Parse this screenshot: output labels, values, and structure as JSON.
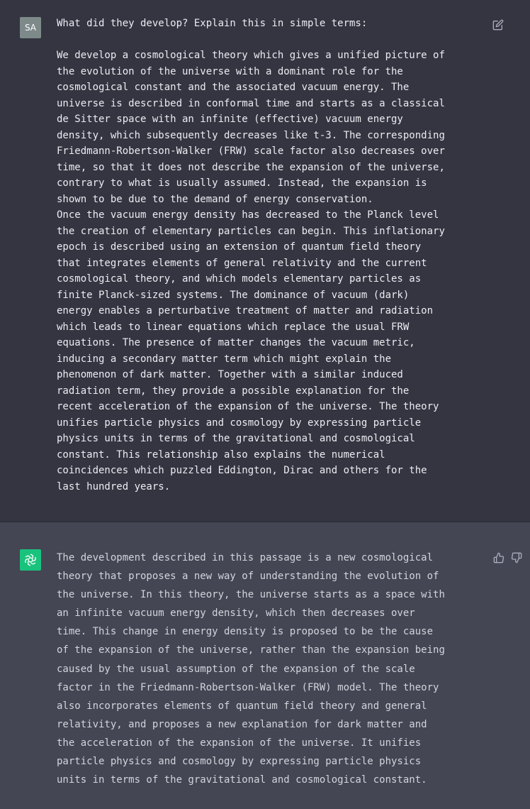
{
  "user_message": {
    "avatar_initials": "SA",
    "text": "What did they develop? Explain this in simple terms:\n\nWe develop a cosmological theory which gives a unified picture of\nthe evolution of the universe with a dominant role for the\ncosmological constant and the associated vacuum energy. The\nuniverse is described in conformal time and starts as a classical\nde Sitter space with an infinite (effective) vacuum energy\ndensity, which subsequently decreases like t-3. The corresponding\nFriedmann-Robertson-Walker (FRW) scale factor also decreases over\ntime, so that it does not describe the expansion of the universe,\ncontrary to what is usually assumed. Instead, the expansion is\nshown to be due to the demand of energy conservation.\nOnce the vacuum energy density has decreased to the Planck level\nthe creation of elementary particles can begin. This inflationary\nepoch is described using an extension of quantum field theory\nthat integrates elements of general relativity and the current\ncosmological theory, and which models elementary particles as\nfinite Planck-sized systems. The dominance of vacuum (dark)\nenergy enables a perturbative treatment of matter and radiation\nwhich leads to linear equations which replace the usual FRW\nequations. The presence of matter changes the vacuum metric,\ninducing a secondary matter term which might explain the\nphenomenon of dark matter. Together with a similar induced\nradiation term, they provide a possible explanation for the\nrecent acceleration of the expansion of the universe. The theory\nunifies particle physics and cosmology by expressing particle\nphysics units in terms of the gravitational and cosmological\nconstant. This relationship also explains the numerical\ncoincidences which puzzled Eddington, Dirac and others for the\nlast hundred years.",
    "edit_icon": "edit-icon"
  },
  "assistant_message": {
    "avatar_icon": "openai-logo-icon",
    "text": "The development described in this passage is a new cosmological\ntheory that proposes a new way of understanding the evolution of\nthe universe. In this theory, the universe starts as a space with\nan infinite vacuum energy density, which then decreases over\ntime. This change in energy density is proposed to be the cause\nof the expansion of the universe, rather than the expansion being\ncaused by the usual assumption of the expansion of the scale\nfactor in the Friedmann-Robertson-Walker (FRW) model. The theory\nalso incorporates elements of quantum field theory and general\nrelativity, and proposes a new explanation for dark matter and\nthe acceleration of the expansion of the universe. It unifies\nparticle physics and cosmology by expressing particle physics\nunits in terms of the gravitational and cosmological constant.",
    "thumbs_up_icon": "thumbs-up-icon",
    "thumbs_down_icon": "thumbs-down-icon"
  },
  "colors": {
    "user_bg": "#343541",
    "assistant_bg": "#444654",
    "user_avatar": "#7d8a89",
    "assistant_avatar": "#19c37d",
    "icon": "#acacbe"
  }
}
